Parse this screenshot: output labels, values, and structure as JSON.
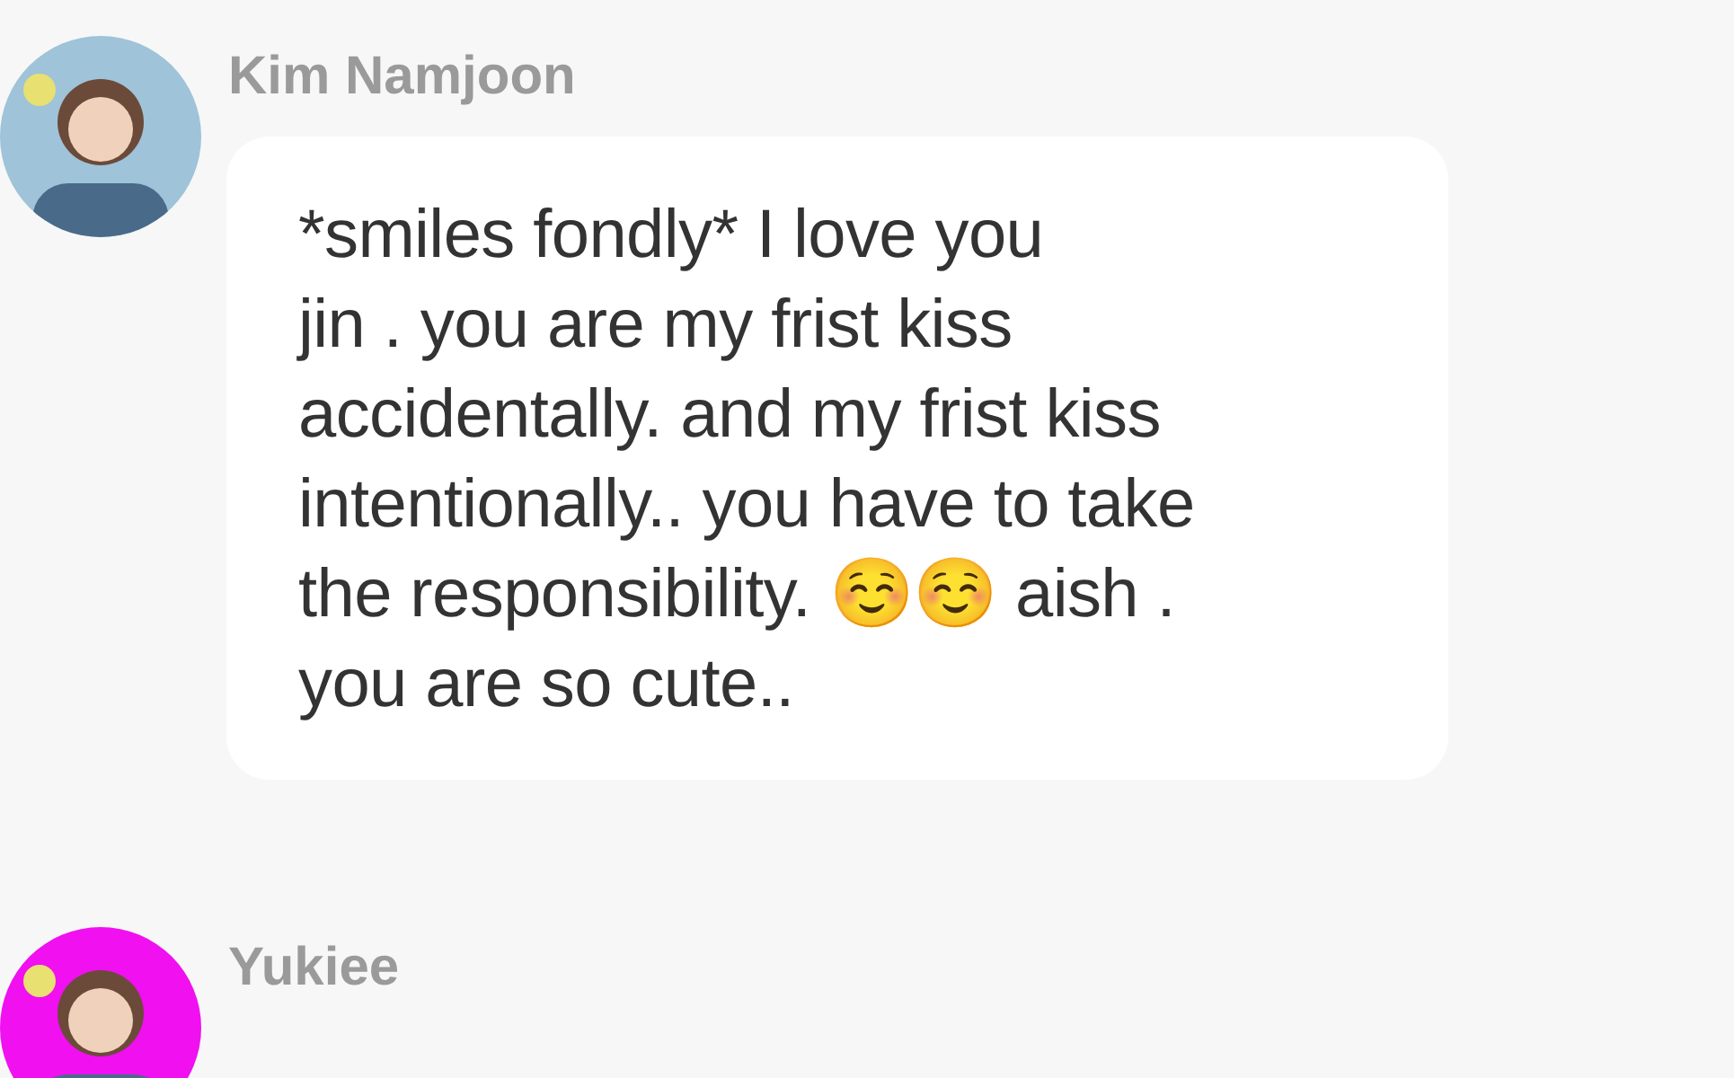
{
  "messages": [
    {
      "author": "Kim Namjoon",
      "lines": [
        "*smiles fondly* I love you",
        "jin . you are my frist kiss",
        "accidentally.  and my frist kiss",
        "intentionally.. you have to take",
        "the responsibility.  ☺️☺️ aish .",
        "you are so cute.."
      ]
    },
    {
      "author": "Yukiee"
    }
  ]
}
